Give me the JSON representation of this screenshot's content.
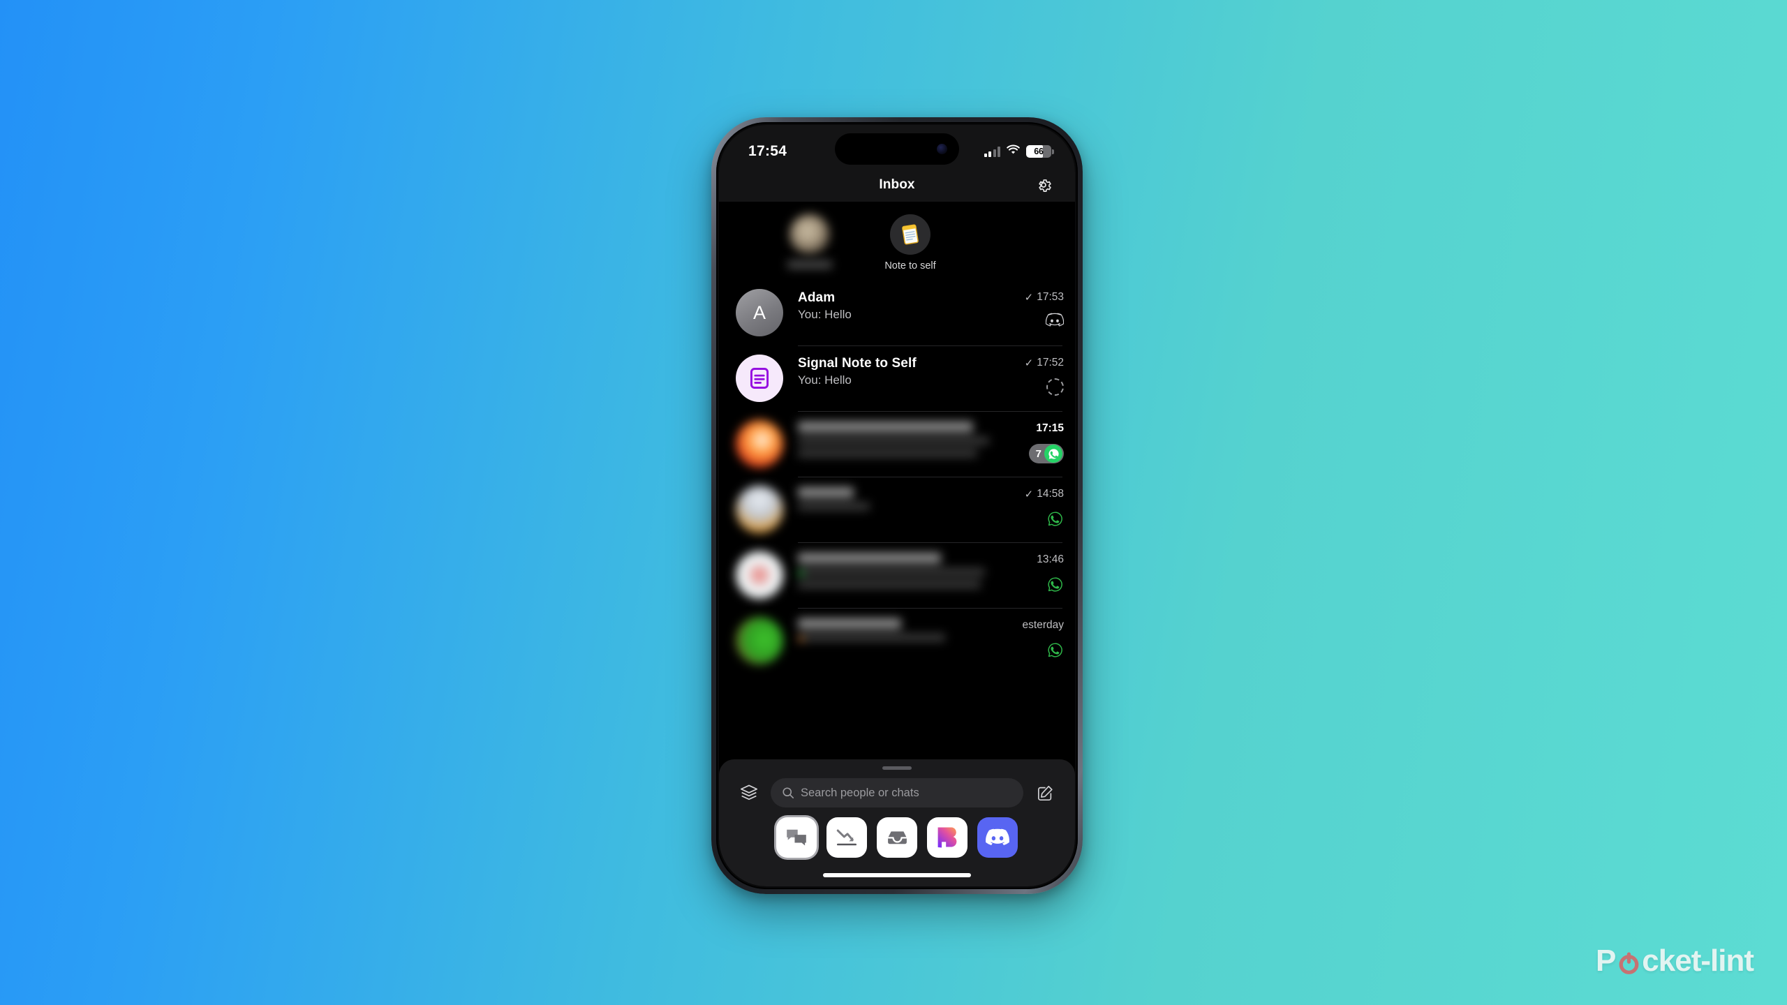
{
  "status_bar": {
    "time": "17:54",
    "battery_level": "66",
    "battery_percent": 66,
    "signal_icon": "cellular-signal-icon",
    "wifi_icon": "wifi-icon",
    "battery_icon": "battery-icon"
  },
  "nav": {
    "title": "Inbox",
    "settings_icon": "gear-icon"
  },
  "pinned": [
    {
      "label": "",
      "avatar_type": "blurred-photo",
      "blurred": true,
      "name": "pinned-blurred-contact"
    },
    {
      "label": "Note to self",
      "avatar_type": "notepad-emoji",
      "blurred": false,
      "name": "pinned-note-to-self"
    }
  ],
  "chats": [
    {
      "name": "Adam",
      "preview": "You: Hello",
      "time": "17:53",
      "read_tick": "✓",
      "avatar_letter": "A",
      "avatar_kind": "initial",
      "badge": "discord-badge",
      "unread": "",
      "blurred": false
    },
    {
      "name": "Signal Note to Self",
      "preview": "You: Hello",
      "time": "17:52",
      "read_tick": "✓",
      "avatar_letter": "",
      "avatar_kind": "signal-note-icon",
      "badge": "pending-dashed-badge",
      "unread": "",
      "blurred": false
    },
    {
      "name": "",
      "preview": "",
      "time": "17:15",
      "read_tick": "",
      "avatar_letter": "",
      "avatar_kind": "blurred-photo",
      "badge": "whatsapp-filled-badge",
      "unread": "7",
      "blurred": true
    },
    {
      "name": "",
      "preview": "",
      "time": "14:58",
      "read_tick": "✓",
      "avatar_letter": "",
      "avatar_kind": "blurred-photo",
      "badge": "whatsapp-outline-badge",
      "unread": "",
      "blurred": true
    },
    {
      "name": "",
      "preview": "",
      "time": "13:46",
      "read_tick": "",
      "avatar_letter": "",
      "avatar_kind": "blurred-photo",
      "badge": "whatsapp-outline-badge",
      "unread": "",
      "blurred": true
    },
    {
      "name": "",
      "preview": "",
      "time": "esterday",
      "read_tick": "",
      "avatar_letter": "",
      "avatar_kind": "blurred-photo",
      "badge": "whatsapp-outline-badge",
      "unread": "",
      "blurred": true
    }
  ],
  "bottom_sheet": {
    "search_placeholder": "Search people or chats",
    "search_value": "",
    "search_icon": "search-icon",
    "layers_icon": "layers-icon",
    "compose_icon": "compose-icon",
    "apps": [
      {
        "name": "chats-app",
        "icon": "chat-bubbles-icon",
        "selected": true
      },
      {
        "name": "trends-app",
        "icon": "declining-chart-icon",
        "selected": false
      },
      {
        "name": "archive-app",
        "icon": "inbox-tray-icon",
        "selected": false
      },
      {
        "name": "beeper-app",
        "icon": "beeper-b-icon",
        "selected": false
      },
      {
        "name": "discord-app",
        "icon": "discord-icon",
        "selected": false
      }
    ]
  },
  "watermark": {
    "text_before": "P",
    "text_after": "cket-lint"
  },
  "colors": {
    "background_start": "#2391f7",
    "background_end": "#5cdcd3",
    "whatsapp_green": "#25d366",
    "discord_blurple": "#5865f2",
    "signal_purple": "#9610e0",
    "unread_pill": "#6d6d71",
    "watermark": "#eef7f4"
  }
}
